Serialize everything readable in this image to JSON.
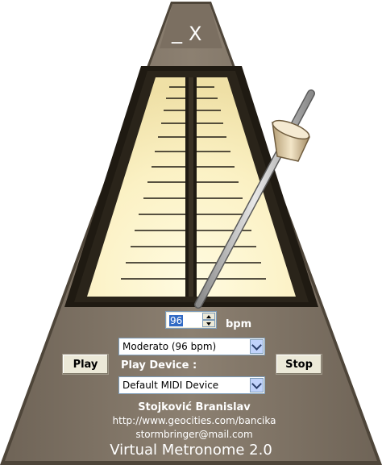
{
  "window": {
    "minimize_glyph": "_",
    "close_glyph": "X"
  },
  "tempo": {
    "value": "96",
    "unit": "bpm"
  },
  "tempo_preset": {
    "selected": "Moderato (96 bpm)"
  },
  "device": {
    "label": "Play Device :",
    "selected": "Default MIDI Device"
  },
  "controls": {
    "play_label": "Play",
    "stop_label": "Stop"
  },
  "credits": {
    "author": "Stojković Branislav",
    "website": "http://www.geocities.com/bancika",
    "email": "stormbringer@mail.com",
    "app_name": "Virtual Metronome 2.0"
  },
  "colors": {
    "body": "#85796c",
    "dark_frame": "#1f1a12",
    "scale_glow": "#fff6c8",
    "pendulum": "#b8b8b8",
    "weight": "#e3d2ae"
  },
  "icons": {
    "minimize": "minimize-icon",
    "close": "close-icon",
    "spin_up": "chevron-up-icon",
    "spin_down": "chevron-down-icon",
    "dropdown": "chevron-down-icon"
  }
}
